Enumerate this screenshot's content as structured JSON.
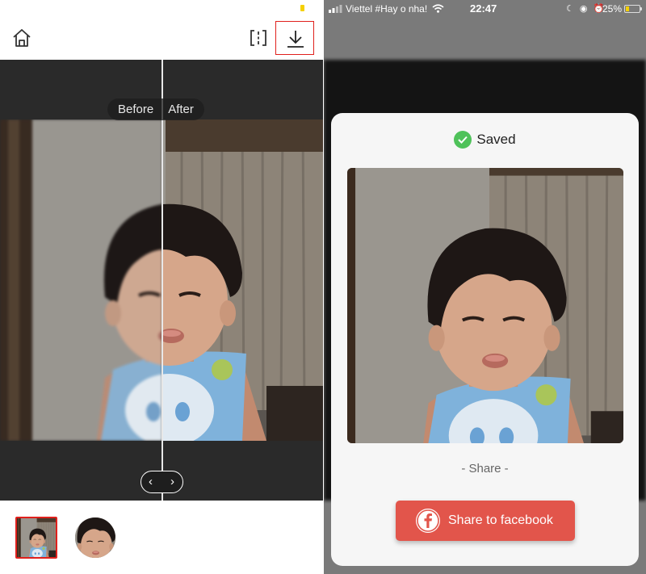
{
  "left_screen": {
    "compare": {
      "before_label": "Before",
      "after_label": "After"
    },
    "slider": {
      "left_glyph": "‹",
      "right_glyph": "›"
    },
    "icons": [
      "home-icon",
      "compare-icon",
      "download-icon",
      "chevron-left-icon",
      "chevron-right-icon"
    ],
    "highlight_color": "#e0201c"
  },
  "right_screen": {
    "status_bar": {
      "carrier": "Viettel #Hay o nha!",
      "time": "22:47",
      "battery": "25%"
    },
    "dialog": {
      "title": "Saved",
      "share_label": "- Share -",
      "share_button": "Share to facebook",
      "check_color": "#4fc25a",
      "button_color": "#e2554b"
    }
  }
}
